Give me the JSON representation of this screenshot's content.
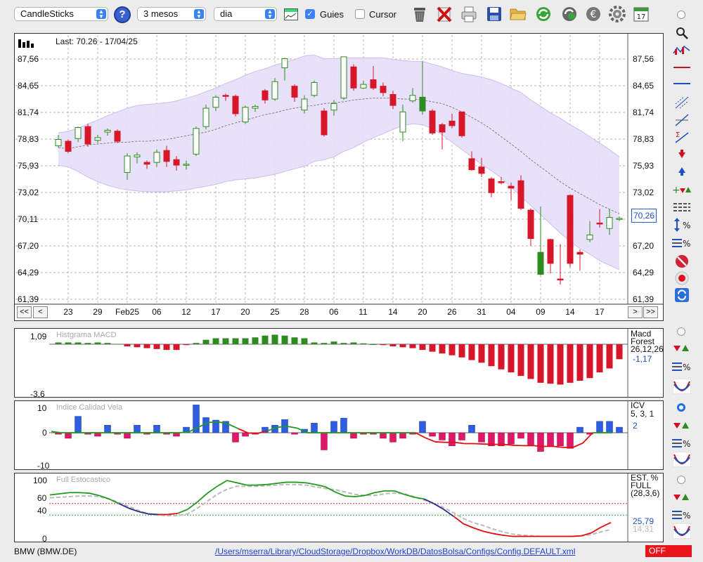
{
  "toolbar": {
    "chart_type": "CandleSticks",
    "period": "3 mesos",
    "interval": "dia",
    "guides_label": "Guies",
    "guides_checked": true,
    "cursor_label": "Cursor",
    "cursor_checked": false,
    "icons": [
      "help-icon",
      "calendar-chart-icon",
      "trash-icon",
      "delete-icon",
      "print-icon",
      "save-icon",
      "open-folder-icon",
      "refresh-icon",
      "update-icon",
      "currency-icon",
      "settings-icon",
      "calendar-icon"
    ]
  },
  "main_chart": {
    "last_label": "Last: 70.26 - 17/04/25",
    "price_tag": "70,26",
    "y_ticks": [
      "87,56",
      "84,65",
      "81,74",
      "78,83",
      "75,93",
      "73,02",
      "70,11",
      "67,20",
      "64,29",
      "61,39"
    ],
    "x_ticks": [
      "23",
      "29",
      "Feb25",
      "06",
      "12",
      "17",
      "20",
      "25",
      "28",
      "06",
      "11",
      "14",
      "20",
      "26",
      "31",
      "04",
      "09",
      "14",
      "17"
    ],
    "nav": {
      "first": "<<",
      "prev": "<",
      "next": ">",
      "last": ">>"
    }
  },
  "macd": {
    "title": "Histgrama MACD",
    "y_top": "1,09",
    "y_bottom": "-3,6",
    "name1": "Macd",
    "name2": "Forest",
    "params": "26,12,26",
    "value": "-1,17"
  },
  "icv": {
    "title": "Indice Calidad Vela",
    "y_top": "10",
    "y_mid": "0",
    "y_bottom": "-10",
    "name": "ICV",
    "params": "5, 3, 1",
    "value": "2"
  },
  "stoch": {
    "title": "Full Estocastico",
    "y_ticks": [
      "100",
      "60",
      "40",
      "0"
    ],
    "name1": "EST. %",
    "name2": "FULL",
    "params": "(28,3,6)",
    "value1": "25,79",
    "value2": "14,31"
  },
  "status": {
    "symbol": "BMW (BMW.DE)",
    "path": "/Users/mserra/Library/CloudStorage/Dropbox/WorkDB/DatosBolsa/Configs/Config.DEFAULT.xml",
    "state": "OFF"
  },
  "chart_data": {
    "type": "candlestick",
    "ylim": [
      61.39,
      87.56
    ],
    "up_color": "#2e8b1f",
    "down_color": "#d8162a",
    "candles": [
      [
        78.1,
        78.8,
        77.9,
        79.3,
        "u"
      ],
      [
        78.6,
        77.5,
        77.3,
        78.8,
        "d"
      ],
      [
        78.9,
        80.1,
        78.5,
        80.2,
        "u"
      ],
      [
        80.2,
        78.3,
        78.0,
        80.5,
        "d"
      ],
      [
        78.7,
        79.0,
        78.4,
        79.3,
        "u"
      ],
      [
        79.6,
        79.8,
        79.2,
        80.0,
        "u"
      ],
      [
        79.7,
        78.6,
        78.4,
        79.9,
        "d"
      ],
      [
        75.2,
        77.0,
        74.4,
        77.3,
        "u"
      ],
      [
        76.9,
        77.1,
        76.2,
        77.4,
        "u"
      ],
      [
        76.3,
        76.1,
        75.6,
        76.5,
        "d"
      ],
      [
        76.3,
        77.4,
        75.8,
        77.7,
        "u"
      ],
      [
        77.6,
        76.4,
        75.8,
        78.1,
        "d"
      ],
      [
        76.6,
        76.0,
        75.4,
        77.0,
        "d"
      ],
      [
        76.0,
        76.1,
        75.5,
        76.5,
        "u"
      ],
      [
        77.2,
        80.0,
        77.0,
        80.2,
        "u"
      ],
      [
        80.2,
        82.2,
        79.9,
        82.6,
        "u"
      ],
      [
        82.3,
        83.4,
        81.9,
        83.6,
        "u"
      ],
      [
        83.6,
        83.5,
        83.0,
        83.8,
        "d"
      ],
      [
        83.5,
        81.6,
        81.3,
        83.7,
        "d"
      ],
      [
        80.7,
        82.3,
        80.5,
        82.5,
        "u"
      ],
      [
        82.2,
        82.4,
        81.8,
        82.6,
        "u"
      ],
      [
        84.1,
        83.1,
        82.7,
        84.3,
        "d"
      ],
      [
        83.2,
        85.1,
        83.0,
        85.5,
        "u"
      ],
      [
        86.6,
        87.6,
        85.2,
        87.7,
        "u"
      ],
      [
        84.6,
        83.4,
        82.9,
        84.8,
        "d"
      ],
      [
        82.0,
        83.2,
        81.6,
        83.6,
        "u"
      ],
      [
        83.6,
        85.0,
        83.4,
        85.2,
        "u"
      ],
      [
        81.9,
        79.3,
        79.1,
        82.2,
        "d"
      ],
      [
        82.0,
        82.7,
        81.4,
        83.1,
        "u"
      ],
      [
        83.3,
        87.8,
        83.1,
        87.8,
        "u"
      ],
      [
        86.7,
        84.4,
        84.1,
        87.0,
        "d"
      ],
      [
        84.4,
        84.8,
        84.3,
        85.2,
        "u"
      ],
      [
        85.3,
        84.4,
        84.2,
        86.8,
        "d"
      ],
      [
        84.6,
        83.9,
        83.5,
        85.0,
        "d"
      ],
      [
        83.7,
        82.5,
        82.1,
        84.1,
        "d"
      ],
      [
        79.6,
        81.8,
        78.6,
        82.6,
        "u"
      ],
      [
        83.0,
        83.6,
        82.8,
        84.4,
        "u"
      ],
      [
        83.4,
        81.9,
        81.5,
        87.3,
        "u"
      ],
      [
        81.9,
        79.5,
        79.3,
        82.1,
        "d"
      ],
      [
        80.4,
        79.6,
        77.7,
        80.6,
        "d"
      ],
      [
        80.8,
        80.3,
        80.0,
        81.6,
        "d"
      ],
      [
        81.8,
        79.2,
        79.0,
        81.8,
        "d"
      ],
      [
        76.7,
        75.5,
        75.4,
        77.5,
        "d"
      ],
      [
        75.8,
        75.1,
        74.7,
        76.8,
        "d"
      ],
      [
        74.5,
        73.0,
        72.5,
        74.7,
        "d"
      ],
      [
        74.2,
        74.1,
        73.9,
        74.7,
        "d"
      ],
      [
        73.7,
        73.5,
        72.2,
        74.1,
        "d"
      ],
      [
        74.3,
        71.3,
        71.1,
        74.9,
        "d"
      ],
      [
        71.1,
        68.0,
        67.2,
        71.3,
        "d"
      ],
      [
        66.5,
        64.1,
        64.0,
        71.5,
        "u"
      ],
      [
        67.9,
        65.3,
        64.2,
        68.0,
        "d"
      ],
      [
        63.6,
        63.5,
        63.0,
        67.4,
        "d"
      ],
      [
        72.7,
        65.3,
        64.9,
        72.8,
        "d"
      ],
      [
        66.5,
        66.3,
        64.5,
        66.8,
        "d"
      ],
      [
        67.9,
        68.4,
        67.6,
        69.9,
        "u"
      ],
      [
        69.7,
        69.6,
        69.2,
        71.2,
        "d"
      ],
      [
        69.1,
        70.3,
        68.4,
        71.2,
        "u"
      ],
      [
        70.1,
        70.2,
        69.9,
        70.4,
        "u"
      ]
    ],
    "mid_line": [
      77.9,
      77.8,
      78.0,
      78.2,
      78.3,
      78.4,
      78.5,
      78.5,
      78.6,
      78.6,
      78.7,
      78.8,
      79.0,
      79.2,
      79.4,
      79.6,
      79.9,
      80.3,
      80.6,
      80.9,
      81.2,
      81.5,
      81.7,
      82.0,
      82.2,
      82.4,
      82.5,
      82.7,
      82.8,
      82.9,
      83.1,
      83.2,
      83.3,
      83.3,
      83.3,
      83.2,
      83.2,
      83.1,
      82.9,
      82.7,
      82.3,
      81.8,
      81.2,
      80.6,
      79.9,
      79.1,
      78.3,
      77.5,
      76.6,
      75.8,
      75.0,
      74.2,
      73.5,
      72.9,
      72.3,
      71.7,
      71.2,
      70.7
    ],
    "upper_band": [
      79.5,
      79.7,
      80.0,
      80.5,
      80.9,
      81.4,
      81.8,
      82.2,
      82.5,
      82.6,
      82.7,
      82.8,
      83.0,
      83.3,
      83.6,
      84.0,
      84.4,
      84.9,
      85.3,
      85.8,
      86.2,
      86.5,
      86.9,
      87.2,
      87.5,
      87.9,
      88.0,
      87.6,
      87.6,
      87.7,
      87.7,
      87.7,
      87.7,
      87.7,
      87.5,
      87.4,
      87.3,
      87.3,
      87.0,
      86.7,
      86.3,
      86.0,
      85.8,
      85.6,
      85.3,
      84.9,
      84.4,
      83.9,
      83.1,
      82.4,
      81.7,
      81.1,
      80.4,
      79.8,
      79.1,
      78.4,
      77.7,
      76.9
    ],
    "lower_band": [
      76.0,
      75.8,
      75.3,
      74.7,
      74.2,
      73.8,
      73.5,
      73.3,
      73.2,
      73.1,
      73.1,
      73.1,
      73.2,
      73.3,
      73.5,
      73.7,
      73.9,
      74.2,
      74.4,
      74.5,
      74.6,
      74.8,
      75.0,
      75.3,
      75.6,
      75.9,
      76.4,
      76.6,
      76.9,
      77.5,
      77.9,
      78.5,
      79.0,
      79.4,
      79.9,
      80.3,
      80.5,
      80.4,
      80.0,
      79.3,
      78.5,
      77.7,
      76.9,
      76.1,
      75.4,
      74.6,
      73.6,
      72.6,
      71.6,
      70.6,
      69.6,
      68.6,
      67.7,
      66.9,
      66.3,
      65.6,
      65.1,
      64.6
    ],
    "macd_hist": [
      0.14,
      0.14,
      0.14,
      0.1,
      0.14,
      0.1,
      0.03,
      -0.17,
      -0.24,
      -0.31,
      -0.38,
      -0.45,
      -0.45,
      -0.07,
      0.1,
      0.35,
      0.47,
      0.47,
      0.47,
      0.47,
      0.54,
      0.68,
      0.75,
      0.68,
      0.54,
      0.47,
      0.14,
      0.1,
      0.21,
      0.1,
      0.14,
      0.07,
      0.0,
      -0.07,
      -0.17,
      -0.24,
      -0.31,
      -0.45,
      -0.59,
      -0.73,
      -0.87,
      -1.04,
      -1.25,
      -1.46,
      -1.73,
      -1.98,
      -2.22,
      -2.5,
      -2.74,
      -3.04,
      -3.11,
      -3.18,
      -3.04,
      -2.88,
      -2.67,
      -2.22,
      -1.91,
      -1.18
    ],
    "icv_bars": [
      -0.6,
      -2.2,
      6.5,
      -0.6,
      -1.4,
      3.0,
      -0.6,
      -2.2,
      3.0,
      -0.6,
      3.0,
      -0.6,
      -1.4,
      2.2,
      11.0,
      6.0,
      5.0,
      4.5,
      -3.7,
      -1.4,
      -0.6,
      2.2,
      3.0,
      5.2,
      -0.6,
      1.4,
      3.8,
      -6.8,
      4.5,
      5.8,
      -2.2,
      -0.6,
      -0.6,
      -2.2,
      -3.7,
      -2.2,
      -0.6,
      4.5,
      -1.4,
      -2.9,
      -5.2,
      -2.9,
      3.0,
      -3.7,
      -5.2,
      -5.2,
      -4.5,
      -2.2,
      -5.2,
      -7.4,
      -5.2,
      -5.2,
      -6.2,
      2.2,
      -0.6,
      4.5,
      4.5,
      2.2
    ],
    "icv_line": [
      0.5,
      0.0,
      0.0,
      0.0,
      0.0,
      0.0,
      0.0,
      0.0,
      0.0,
      0.0,
      0.0,
      0.0,
      0.0,
      0.0,
      0.4,
      2.3,
      4.1,
      4.3,
      3.4,
      1.6,
      -0.1,
      -0.2,
      0.8,
      2.2,
      2.5,
      1.8,
      0.0,
      0.0,
      0.0,
      0.0,
      0.0,
      0.0,
      0.0,
      0.0,
      0.0,
      0.0,
      0.0,
      0.0,
      -2.0,
      -3.6,
      -3.8,
      -3.8,
      -4.3,
      -4.3,
      -4.5,
      -4.6,
      -4.6,
      -5.0,
      -5.1,
      -5.1,
      -5.4,
      -5.4,
      -5.8,
      -5.8,
      -4.1,
      0.0,
      0.0,
      0.0
    ],
    "stoch_k": [
      75,
      77,
      79,
      79,
      78,
      74,
      68,
      60,
      52,
      46,
      42,
      41,
      41,
      43,
      50,
      63,
      78,
      90,
      100,
      96,
      92,
      92,
      93,
      95,
      97,
      97,
      96,
      93,
      89,
      80,
      73,
      72,
      74,
      79,
      82,
      82,
      76,
      71,
      68,
      60,
      50,
      38,
      25,
      18,
      12,
      8,
      5,
      3,
      3,
      3,
      3,
      3,
      3,
      3,
      4,
      9,
      19,
      27
    ],
    "stoch_d": [
      70,
      71,
      72,
      73,
      73,
      72,
      68,
      62,
      55,
      48,
      42,
      40,
      39,
      39,
      42,
      52,
      64,
      76,
      85,
      90,
      90,
      90,
      91,
      92,
      93,
      93,
      92,
      89,
      86,
      84,
      80,
      76,
      74,
      74,
      77,
      78,
      77,
      72,
      66,
      60,
      53,
      44,
      34,
      27,
      22,
      16,
      11,
      7,
      5,
      4,
      3,
      3,
      3,
      3,
      4,
      6,
      11,
      15
    ]
  }
}
